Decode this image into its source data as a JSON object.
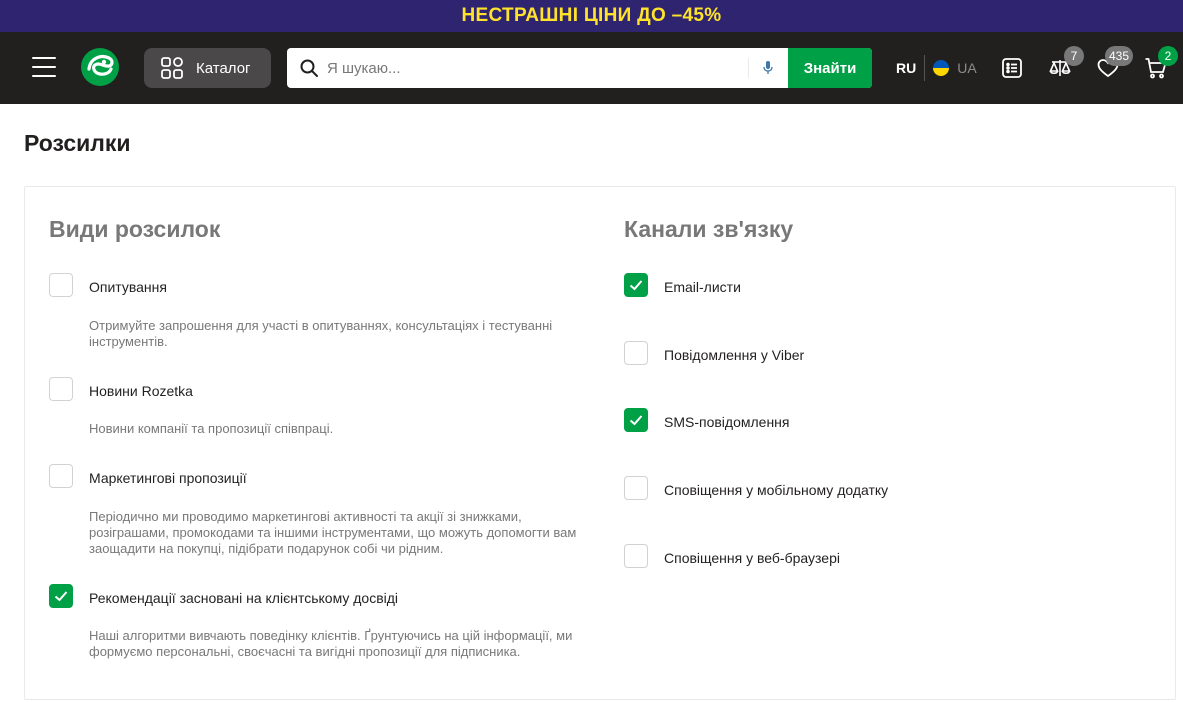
{
  "promo": {
    "text": "НЕСТРАШНІ ЦІНИ ДО –45%",
    "bg_color": "#2f2470",
    "text_color": "#ffe32b"
  },
  "header": {
    "menu_icon": "hamburger-icon",
    "logo_icon": "rozetka-logo-icon",
    "catalog": {
      "label": "Каталог",
      "icon": "catalog-grid-icon"
    },
    "search": {
      "placeholder": "Я шукаю...",
      "value": "",
      "button_label": "Знайти",
      "icon": "search-icon",
      "mic_icon": "microphone-icon"
    },
    "language": {
      "active": "RU",
      "inactive": "UA"
    },
    "icons": {
      "orders": "orders-list-icon",
      "compare": {
        "icon": "compare-scales-icon",
        "count": "7"
      },
      "wishlist": {
        "icon": "heart-icon",
        "count": "435"
      },
      "cart": {
        "icon": "cart-icon",
        "count": "2"
      }
    },
    "accent_color": "#00a046"
  },
  "page": {
    "title": "Розсилки",
    "newsletter_types": {
      "title": "Види розсилок",
      "items": [
        {
          "label": "Опитування",
          "checked": false,
          "description": "Отримуйте запрошення для участі в опитуваннях, консультаціях і тестуванні інструментів."
        },
        {
          "label": "Новини Rozetka",
          "checked": false,
          "description": "Новини компанії та пропозиції співпраці."
        },
        {
          "label": "Маркетингові пропозиції",
          "checked": false,
          "description": "Періодично ми проводимо маркетингові активності та акції зі знижками, розіграшами, промокодами та іншими інструментами, що можуть допомогти вам заощадити на покупці, підібрати подарунок собі чи рідним."
        },
        {
          "label": "Рекомендації засновані на клієнтському досвіді",
          "checked": true,
          "description": "Наші алгоритми вивчають поведінку клієнтів. Ґрунтуючись на цій інформації, ми формуємо персональні, своєчасні та вигідні пропозиції для підписника."
        }
      ]
    },
    "channels": {
      "title": "Канали зв'язку",
      "items": [
        {
          "label": "Email-листи",
          "checked": true
        },
        {
          "label": "Повідомлення у Viber",
          "checked": false
        },
        {
          "label": "SMS-повідомлення",
          "checked": true
        },
        {
          "label": "Сповіщення у мобільному додатку",
          "checked": false
        },
        {
          "label": "Сповіщення у веб-браузері",
          "checked": false
        }
      ]
    }
  }
}
